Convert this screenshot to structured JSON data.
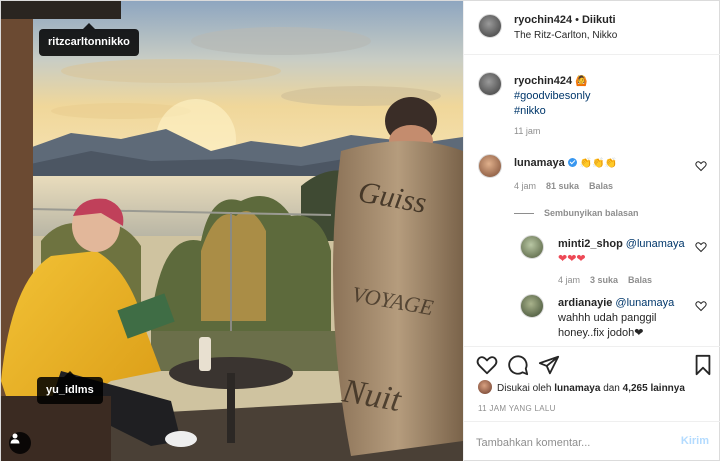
{
  "photo": {
    "tags": [
      {
        "label": "ritzcarltonnikko"
      },
      {
        "label": "yu_idlms"
      }
    ],
    "blanket_text": "Guiss VOYAGE"
  },
  "header": {
    "username": "ryochin424",
    "follow_status": "Diikuti",
    "location": "The Ritz-Carlton, Nikko"
  },
  "caption": {
    "username": "ryochin424",
    "emoji": "🙆",
    "hashtags": [
      "#goodvibesonly",
      "#nikko"
    ],
    "time": "11 jam"
  },
  "comments": [
    {
      "username": "lunamaya",
      "verified": true,
      "text": "👏👏👏",
      "time": "4 jam",
      "likes": "81 suka",
      "reply_label": "Balas"
    }
  ],
  "hide_replies": "Sembunyikan balasan",
  "replies": [
    {
      "username": "minti2_shop",
      "mention": "@lunamaya",
      "text": "❤❤❤",
      "time": "4 jam",
      "likes": "3 suka",
      "reply_label": "Balas"
    },
    {
      "username": "ardianayie",
      "mention": "@lunamaya",
      "text": "wahhh udah panggil honey..fix jodoh❤",
      "line1": "wahhh udah panggil",
      "line2": "honey..fix jodoh❤"
    }
  ],
  "actions": {
    "liked_prefix": "Disukai oleh",
    "liked_user": "lunamaya",
    "liked_join": "dan",
    "liked_count": "4,265 lainnya",
    "date": "11 JAM YANG LALU"
  },
  "add_comment": {
    "placeholder": "Tambahkan komentar...",
    "post_label": "Kirim"
  },
  "colors": {
    "link": "#00376b",
    "verified": "#3897f0",
    "heart": "#ed4956",
    "post_disabled": "#b3dbff"
  },
  "icons": [
    "heart-icon",
    "comment-icon",
    "share-icon",
    "bookmark-icon",
    "user-tags-icon",
    "verified-badge-icon"
  ]
}
